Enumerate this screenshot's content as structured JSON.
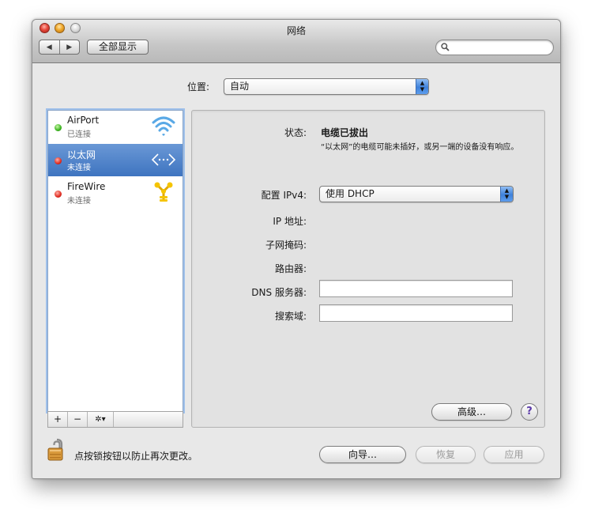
{
  "window": {
    "title": "网络"
  },
  "toolbar": {
    "back_glyph": "◀",
    "forward_glyph": "▶",
    "show_all_label": "全部显示",
    "search": {
      "placeholder": "",
      "icon": "magnifier-icon"
    }
  },
  "location": {
    "label": "位置:",
    "value": "自动"
  },
  "services": [
    {
      "name": "AirPort",
      "status": "已连接",
      "indicator_color": "#38b21d",
      "icon": "wifi-icon",
      "selected": false
    },
    {
      "name": "以太网",
      "status": "未连接",
      "indicator_color": "#e02a1f",
      "icon": "ethernet-icon",
      "selected": true
    },
    {
      "name": "FireWire",
      "status": "未连接",
      "indicator_color": "#e02a1f",
      "icon": "firewire-icon",
      "selected": false
    }
  ],
  "sidebar_tools": {
    "add": "+",
    "remove": "−",
    "action": "✲▾"
  },
  "detail": {
    "status_label": "状态:",
    "status_value": "电缆已拔出",
    "status_description": "“以太网”的电缆可能未插好，或另一端的设备没有响应。",
    "configure_label": "配置 IPv4:",
    "configure_value": "使用 DHCP",
    "ip_label": "IP 地址:",
    "subnet_label": "子网掩码:",
    "router_label": "路由器:",
    "dns_label": "DNS 服务器:",
    "dns_value": "",
    "search_domains_label": "搜索域:",
    "search_domains_value": "",
    "advanced_button": "高级…",
    "help_button": "?"
  },
  "footer": {
    "lock_text": "点按锁按钮以防止再次更改。",
    "assist_button": "向导…",
    "revert_button": "恢复",
    "apply_button": "应用"
  },
  "colors": {
    "selection": "#3e74c0",
    "connected": "#38b21d",
    "disconnected": "#e02a1f",
    "accent": "#3f82db"
  }
}
